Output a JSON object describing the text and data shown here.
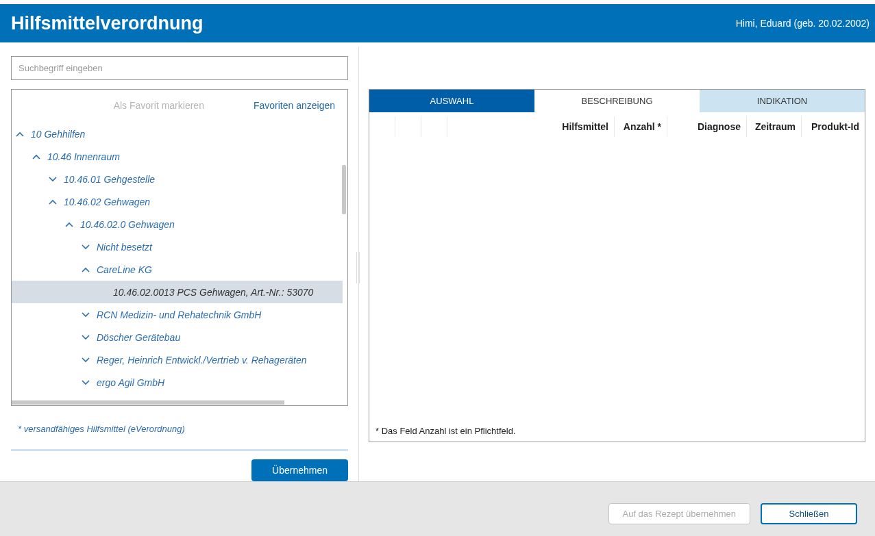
{
  "header": {
    "title": "Hilfsmittelverordnung",
    "patient": "Himi, Eduard (geb. 20.02.2002)"
  },
  "search": {
    "placeholder": "Suchbegriff eingeben"
  },
  "tree_toolbar": {
    "mark_favorite": {
      "label": "Als Favorit markieren",
      "disabled": true
    },
    "show_favorites": {
      "label": "Favoriten anzeigen",
      "disabled": false
    }
  },
  "tree": [
    {
      "kind": "group",
      "label": "10 Gehhilfen",
      "expanded": true,
      "selected": false,
      "children": [
        {
          "kind": "group",
          "label": "10.46 Innenraum",
          "expanded": true,
          "selected": false,
          "children": [
            {
              "kind": "group",
              "label": "10.46.01 Gehgestelle",
              "expanded": false,
              "selected": false
            },
            {
              "kind": "group",
              "label": "10.46.02 Gehwagen",
              "expanded": true,
              "selected": false,
              "children": [
                {
                  "kind": "group",
                  "label": "10.46.02.0 Gehwagen",
                  "expanded": true,
                  "selected": false,
                  "children": [
                    {
                      "kind": "group",
                      "label": "Nicht besetzt",
                      "expanded": false,
                      "selected": false
                    },
                    {
                      "kind": "group",
                      "label": "CareLine KG",
                      "expanded": true,
                      "selected": false,
                      "children": [
                        {
                          "kind": "item",
                          "label": "10.46.02.0013 PCS Gehwagen, Art.-Nr.: 53070",
                          "selected": true
                        }
                      ]
                    },
                    {
                      "kind": "group",
                      "label": "RCN Medizin- und Rehatechnik GmbH",
                      "expanded": false,
                      "selected": false
                    },
                    {
                      "kind": "group",
                      "label": "Döscher Gerätebau",
                      "expanded": false,
                      "selected": false
                    },
                    {
                      "kind": "group",
                      "label": "Reger, Heinrich Entwickl./Vertrieb v. Rehageräten",
                      "expanded": false,
                      "selected": false
                    },
                    {
                      "kind": "group",
                      "label": "ergo Agil GmbH",
                      "expanded": false,
                      "selected": false
                    }
                  ]
                }
              ]
            }
          ]
        }
      ]
    }
  ],
  "footnote": "* versandfähiges Hilfsmittel (eVerordnung)",
  "apply_button": {
    "label": "Übernehmen"
  },
  "tabs": [
    {
      "label": "AUSWAHL",
      "selected": true,
      "color": "#005ea8"
    },
    {
      "label": "BESCHREIBUNG",
      "selected": false,
      "color": "#ffffff"
    },
    {
      "label": "INDIKATION",
      "selected": false,
      "color": "#cce3f2"
    }
  ],
  "table": {
    "columns": [
      "",
      "",
      "",
      "Hilfsmittel",
      "Anzahl *",
      "Diagnose",
      "Zeitraum",
      "Produkt-Id"
    ]
  },
  "table_note": "* Das Feld Anzahl ist ein Pflichtfeld.",
  "footer_buttons": [
    {
      "label": "Auf das Rezept übernehmen",
      "disabled": true
    },
    {
      "label": "Schließen",
      "disabled": false
    }
  ]
}
